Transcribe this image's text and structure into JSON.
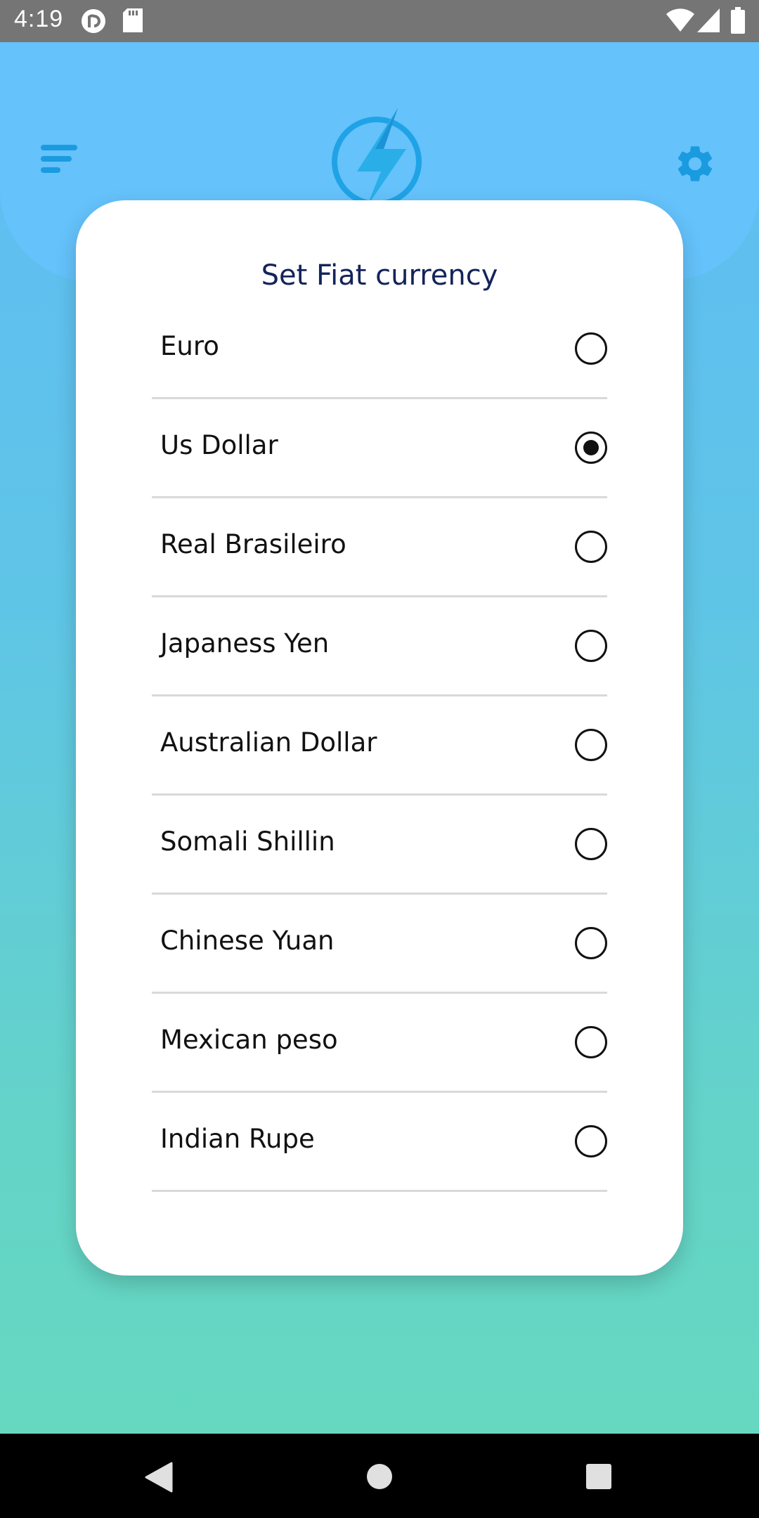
{
  "status_bar": {
    "time": "4:19",
    "icons": [
      "pocket-casts-icon",
      "sd-card-icon",
      "wifi-icon",
      "signal-icon",
      "battery-icon"
    ]
  },
  "header": {
    "menu_icon": "menu-icon",
    "logo_icon": "lightning-bolt-icon",
    "settings_icon": "gear-icon"
  },
  "colors": {
    "accent": "#1a9be0",
    "title": "#14235a",
    "gradient_top": "#5fbcf7",
    "gradient_bottom": "#66d9be"
  },
  "dialog": {
    "title": "Set Fiat currency",
    "selected": "Us Dollar",
    "options": [
      {
        "label": "Euro",
        "checked": false
      },
      {
        "label": "Us Dollar",
        "checked": true
      },
      {
        "label": "Real Brasileiro",
        "checked": false
      },
      {
        "label": "Japaness Yen",
        "checked": false
      },
      {
        "label": "Australian Dollar",
        "checked": false
      },
      {
        "label": "Somali Shillin",
        "checked": false
      },
      {
        "label": "Chinese Yuan",
        "checked": false
      },
      {
        "label": "Mexican peso",
        "checked": false
      },
      {
        "label": "Indian Rupe",
        "checked": false
      }
    ]
  },
  "nav_bar": {
    "buttons": [
      "back-icon",
      "home-icon",
      "recents-icon"
    ]
  }
}
